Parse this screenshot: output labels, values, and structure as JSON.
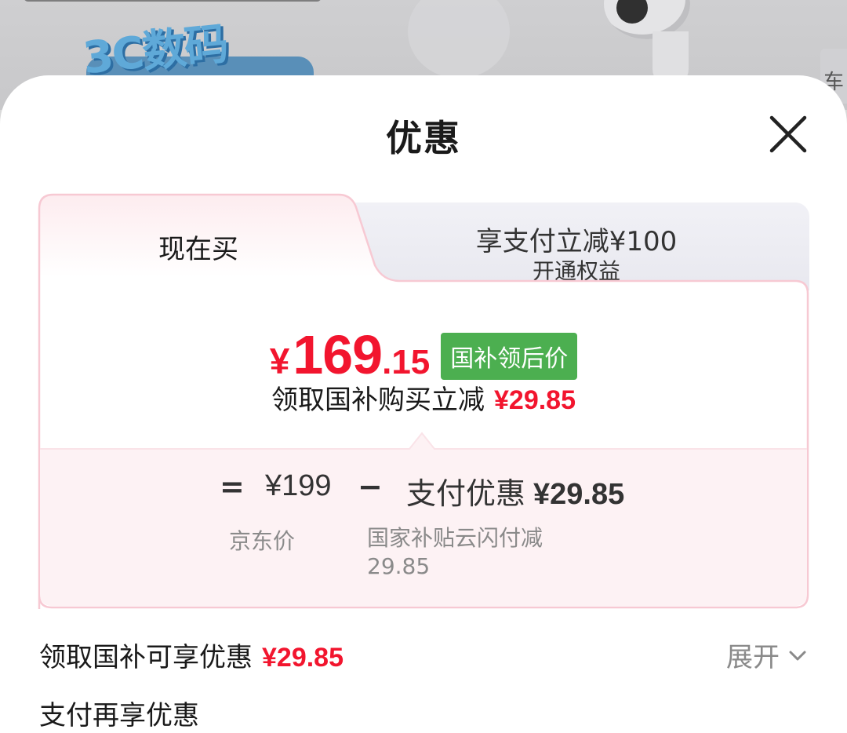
{
  "background": {
    "badge_text": "3C数码",
    "side_tab_text": "车"
  },
  "sheet": {
    "title": "优惠"
  },
  "tabs": {
    "active_label": "现在买",
    "inactive_main": "享支付立减¥100",
    "inactive_sub": "开通权益"
  },
  "price": {
    "symbol": "¥",
    "integer": "169",
    "decimal": ".15",
    "badge": "国补领后价"
  },
  "reduce": {
    "label": "领取国补购买立减",
    "amount": "¥29.85"
  },
  "formula": {
    "eq": "=",
    "base_price": "¥199",
    "minus": "−",
    "discount_label": "支付优惠",
    "discount_amount": "¥29.85",
    "base_note": "京东价",
    "discount_note": "国家补贴云闪付减29.85"
  },
  "rows": {
    "national_label": "领取国补可享优惠",
    "national_amount": "¥29.85",
    "expand_label": "展开",
    "pay_label": "支付再享优惠"
  },
  "colors": {
    "accent_red": "#f2152e",
    "badge_green": "#4caf50",
    "card_border": "#f7c9d3"
  }
}
